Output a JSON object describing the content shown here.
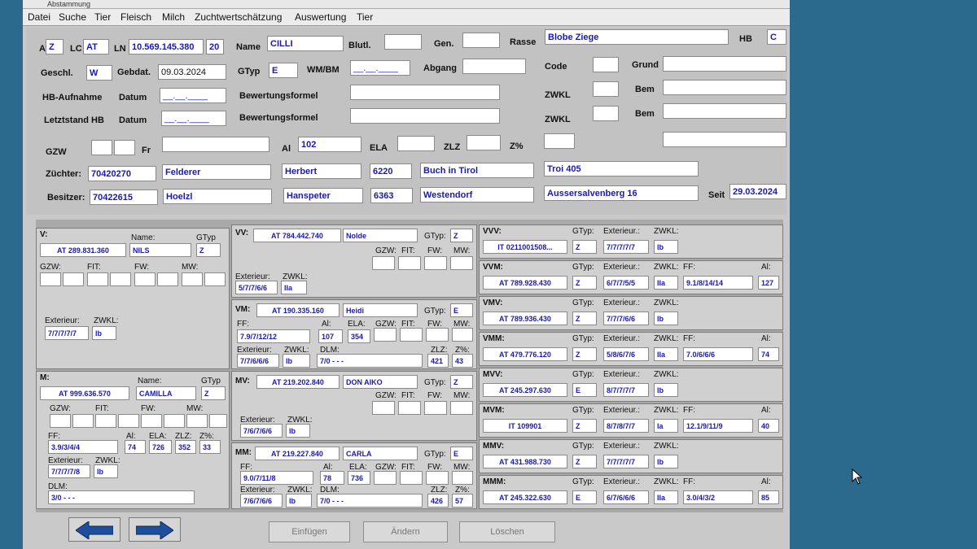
{
  "window": {
    "title": "Abstammung"
  },
  "menu": [
    "Datei",
    "Suche",
    "Tier",
    "Fleisch",
    "Milch",
    "Zuchtwertschätzung",
    "Auswertung",
    "Tier"
  ],
  "animal": {
    "a_label": "A",
    "a": "Z",
    "lc_label": "LC",
    "lc": "AT",
    "ln_label": "LN",
    "ln": "10.569.145.380",
    "ln_suffix": "20",
    "name_label": "Name",
    "name": "CILLI",
    "blutl_label": "Blutl.",
    "blutl": "",
    "gen_label": "Gen.",
    "gen": "",
    "rasse_label": "Rasse",
    "rasse": "Blobe Ziege",
    "hb_label": "HB",
    "hb": "C",
    "geschl_label": "Geschl.",
    "geschl": "W",
    "gebdat_label": "Gebdat.",
    "gebdat": "09.03.2024",
    "gtyp_label": "GTyp",
    "gtyp": "E",
    "wmbm_label": "WM/BM",
    "wmbm": "__.__.____",
    "abgang_label": "Abgang",
    "abgang": "",
    "code_label": "Code",
    "code": "",
    "grund_label": "Grund",
    "grund": "",
    "hb_aufnahme_label": "HB-Aufnahme",
    "datum1_label": "Datum",
    "datum1": "__.__.____",
    "bewertung1_label": "Bewertungsformel",
    "bewertung1": "",
    "zwkl1_label": "ZWKL",
    "zwkl1": "",
    "bem1_label": "Bem",
    "bem1": "",
    "letztstand_label": "Letztstand HB",
    "datum2_label": "Datum",
    "datum2": "__.__.____",
    "bewertung2_label": "Bewertungsformel",
    "bewertung2": "",
    "zwkl2_label": "ZWKL",
    "zwkl2": "",
    "bem2_label": "Bem",
    "bem2": "",
    "gzw_label": "GZW",
    "fr_label": "Fr",
    "al_label": "Al",
    "al": "102",
    "ela_label": "ELA",
    "ela": "",
    "zlz_label": "ZLZ",
    "zlz": "",
    "zp_label": "Z%",
    "zp": ""
  },
  "zuechter": {
    "label": "Züchter:",
    "nr": "70420270",
    "nachname": "Felderer",
    "vorname": "Herbert",
    "plz": "6220",
    "ort": "Buch in Tirol",
    "adresse": "Troi 405"
  },
  "besitzer": {
    "label": "Besitzer:",
    "nr": "70422615",
    "nachname": "Hoelzl",
    "vorname": "Hanspeter",
    "plz": "6363",
    "ort": "Westendorf",
    "adresse": "Aussersalvenberg 16",
    "seit_label": "Seit",
    "seit": "29.03.2024"
  },
  "lab": {
    "name": "Name:",
    "gtyp": "GTyp",
    "gtyp_c": "GTyp:",
    "gzw": "GZW:",
    "fit": "FIT:",
    "fw": "FW:",
    "mw": "MW:",
    "ext": "Exterieur:",
    "ext2": "Exterieur.:",
    "zwkl": "ZWKL:",
    "ff": "FF:",
    "al": "Al:",
    "ela": "ELA:",
    "zlz": "ZLZ:",
    "zp": "Z%:",
    "dlm": "DLM:"
  },
  "V": {
    "label": "V:",
    "id": "AT 289.831.360",
    "name": "NILS",
    "gtyp": "Z",
    "ext": "7/7/7/7/7",
    "zwkl": "lb"
  },
  "M": {
    "label": "M:",
    "id": "AT 999.636.570",
    "name": "CAMILLA",
    "gtyp": "Z",
    "ff": "3.9/3/4/4",
    "al": "74",
    "ela": "726",
    "zlz": "352",
    "zp": "33",
    "ext": "7/7/7/7/8",
    "zwkl": "lb",
    "dlm": "3/0 - - -"
  },
  "VV": {
    "label": "VV:",
    "id": "AT 784.442.740",
    "name": "Nolde",
    "gtyp": "Z",
    "ext": "5/7/7/6/6",
    "zwkl": "IIa"
  },
  "VM": {
    "label": "VM:",
    "id": "AT 190.335.160",
    "name": "Heidi",
    "gtyp": "E",
    "ff": "7.9/7/12/12",
    "al": "107",
    "ela": "354",
    "ext": "7/7/6/6/6",
    "zwkl": "lb",
    "dlm": "7/0 - - -",
    "zlz": "421",
    "zp": "43"
  },
  "MV": {
    "label": "MV:",
    "id": "AT 219.202.840",
    "name": "DON AIKO",
    "gtyp": "Z",
    "ext": "7/6/7/6/6",
    "zwkl": "lb"
  },
  "MM": {
    "label": "MM:",
    "id": "AT 219.227.840",
    "name": "CARLA",
    "gtyp": "E",
    "ff": "9.0/7/11/8",
    "al": "78",
    "ela": "736",
    "ext": "7/6/7/6/6",
    "zwkl": "lb",
    "dlm": "7/0 - - -",
    "zlz": "426",
    "zp": "57"
  },
  "VVV": {
    "label": "VVV:",
    "id": "IT 0211001508...",
    "gtyp": "Z",
    "ext": "7/7/7/7/7",
    "zwkl": "lb"
  },
  "VVM": {
    "label": "VVM:",
    "id": "AT 789.928.430",
    "gtyp": "Z",
    "ext": "6/7/7/5/5",
    "zwkl": "IIa",
    "ff": "9.1/8/14/14",
    "al": "127"
  },
  "VMV": {
    "label": "VMV:",
    "id": "AT 789.936.430",
    "gtyp": "Z",
    "ext": "7/7/7/6/6",
    "zwkl": "lb"
  },
  "VMM": {
    "label": "VMM:",
    "id": "AT 479.776.120",
    "gtyp": "Z",
    "ext": "5/8/6/7/6",
    "zwkl": "IIa",
    "ff": "7.0/6/6/6",
    "al": "74"
  },
  "MVV": {
    "label": "MVV:",
    "id": "AT 245.297.630",
    "gtyp": "E",
    "ext": "8/7/7/7/7",
    "zwkl": "lb"
  },
  "MVM": {
    "label": "MVM:",
    "id": "IT 109901",
    "gtyp": "Z",
    "ext": "8/7/8/7/7",
    "zwkl": "la",
    "ff": "12.1/9/11/9",
    "al": "40"
  },
  "MMV": {
    "label": "MMV:",
    "id": "AT 431.988.730",
    "gtyp": "Z",
    "ext": "7/7/7/7/7",
    "zwkl": "lb"
  },
  "MMM": {
    "label": "MMM:",
    "id": "AT 245.322.630",
    "gtyp": "E",
    "ext": "6/7/6/6/6",
    "zwkl": "IIa",
    "ff": "3.0/4/3/2",
    "al": "85"
  },
  "buttons": {
    "einfuegen": "Einfügen",
    "aendern": "Ändern",
    "loeschen": "Löschen"
  },
  "colors": {
    "field_text": "#1a1ab0",
    "arrow": "#1f4f9c",
    "desktop": "#2b6a8c"
  }
}
